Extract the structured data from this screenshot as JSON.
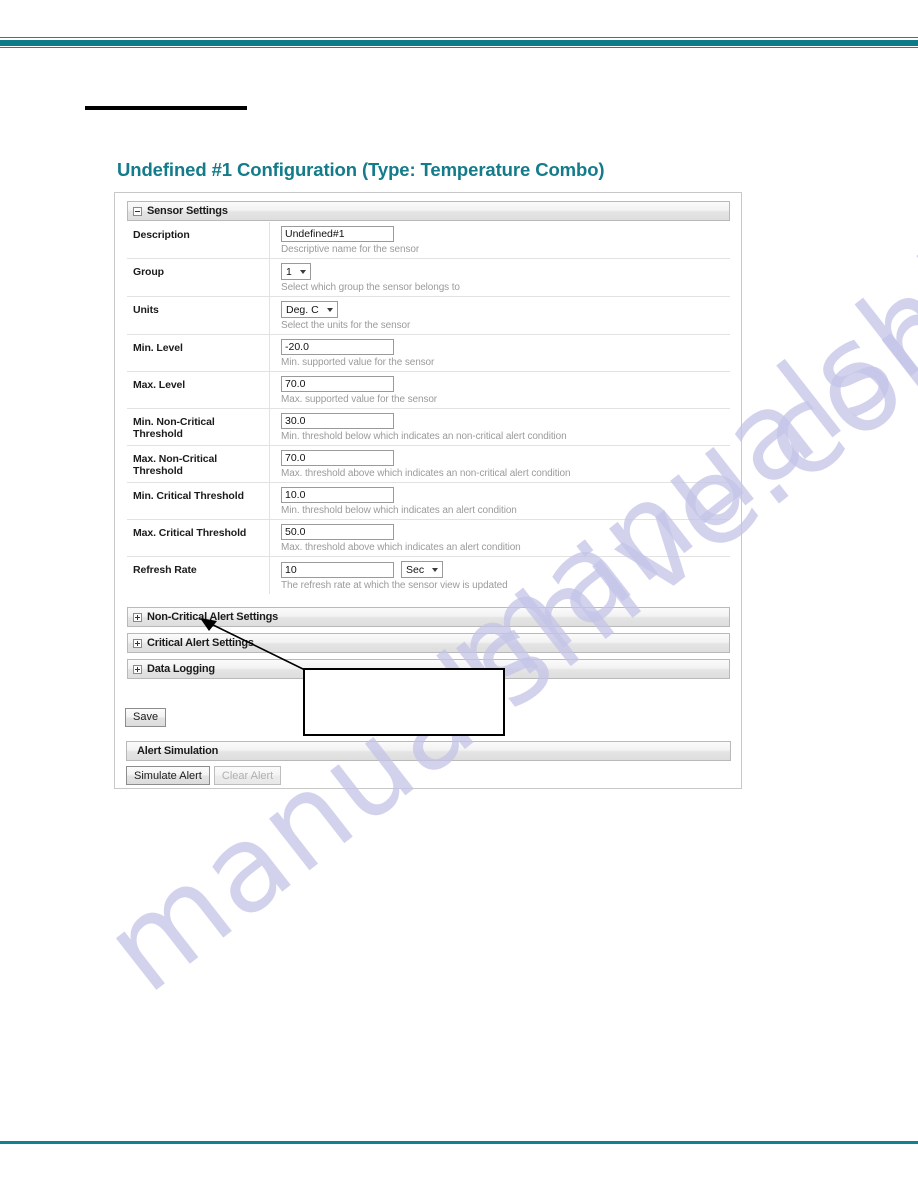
{
  "page": {
    "title": "Undefined #1 Configuration (Type: Temperature Combo)",
    "watermark": "manualshive.com",
    "accent_color": "#137b8a",
    "rule_color": "#0d7a87"
  },
  "sensor_settings": {
    "header": "Sensor Settings",
    "expander_icon": "minus-box-icon",
    "rows": [
      {
        "label": "Description",
        "control": "text",
        "value": "Undefined#1",
        "hint": "Descriptive name for the sensor"
      },
      {
        "label": "Group",
        "control": "select",
        "value": "1",
        "hint": "Select which group the sensor belongs to"
      },
      {
        "label": "Units",
        "control": "select",
        "value": "Deg. C",
        "hint": "Select the units for the sensor"
      },
      {
        "label": "Min. Level",
        "control": "text",
        "value": "-20.0",
        "hint": "Min. supported value for the sensor"
      },
      {
        "label": "Max. Level",
        "control": "text",
        "value": "70.0",
        "hint": "Max. supported value for the sensor"
      },
      {
        "label": "Min. Non-Critical Threshold",
        "control": "text",
        "value": "30.0",
        "hint": "Min. threshold below which indicates an non-critical alert condition"
      },
      {
        "label": "Max. Non-Critical Threshold",
        "control": "text",
        "value": "70.0",
        "hint": "Max. threshold above which indicates an non-critical alert condition"
      },
      {
        "label": "Min. Critical Threshold",
        "control": "text",
        "value": "10.0",
        "hint": "Min. threshold below which indicates an alert condition"
      },
      {
        "label": "Max. Critical Threshold",
        "control": "text",
        "value": "50.0",
        "hint": "Max. threshold above which indicates an alert condition"
      },
      {
        "label": "Refresh Rate",
        "control": "text_plus_select",
        "value": "10",
        "unit_value": "Sec",
        "hint": "The refresh rate at which the sensor view is updated"
      }
    ]
  },
  "collapsed_sections": [
    {
      "header": "Non-Critical Alert Settings",
      "expander_icon": "plus-box-icon"
    },
    {
      "header": "Critical Alert Settings",
      "expander_icon": "plus-box-icon"
    },
    {
      "header": "Data Logging",
      "expander_icon": "plus-box-icon"
    }
  ],
  "actions": {
    "save_label": "Save"
  },
  "alert_simulation": {
    "header": "Alert Simulation",
    "simulate_label": "Simulate Alert",
    "clear_label": "Clear Alert",
    "clear_disabled": true
  }
}
